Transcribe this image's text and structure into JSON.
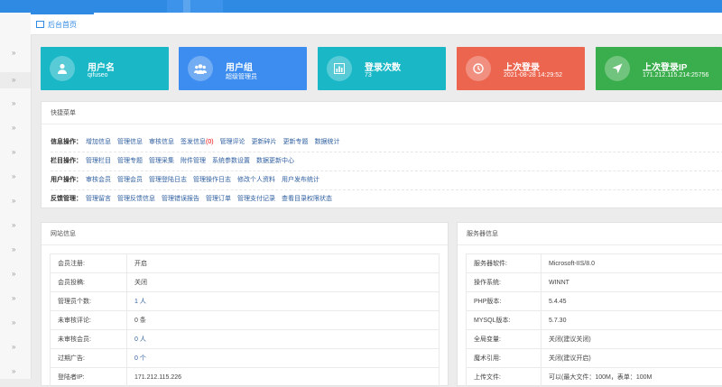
{
  "tab": {
    "label": "后台首页"
  },
  "stats": [
    {
      "title": "用户名",
      "value": "qifuseo",
      "color": "#1ab7c7",
      "icon": "user-icon"
    },
    {
      "title": "用户组",
      "value": "超级管理员",
      "color": "#3c8def",
      "icon": "group-icon"
    },
    {
      "title": "登录次数",
      "value": "73",
      "color": "#1ab7c7",
      "icon": "chart-icon"
    },
    {
      "title": "上次登录",
      "value": "2021-08-28 14:29:52",
      "color": "#ec654f",
      "icon": "clock-icon"
    },
    {
      "title": "上次登录IP",
      "value": "171.212.115.214:25756",
      "color": "#3aae4c",
      "icon": "location-arrow-icon"
    }
  ],
  "quick_menu": {
    "title": "快捷菜单",
    "rows": [
      {
        "label": "信息操作：",
        "links": [
          "增加信息",
          "管理信息",
          "审核信息",
          "签发信息",
          "管理评论",
          "更新碎片",
          "更新专题",
          "数据统计"
        ],
        "badge": "(0)"
      },
      {
        "label": "栏目操作：",
        "links": [
          "管理栏目",
          "管理专题",
          "管理采集",
          "附件管理",
          "系统参数设置",
          "数据更新中心"
        ]
      },
      {
        "label": "用户操作：",
        "links": [
          "审核会员",
          "管理会员",
          "管理登陆日志",
          "管理操作日志",
          "修改个人资料",
          "用户发布统计"
        ]
      },
      {
        "label": "反馈管理：",
        "links": [
          "管理留言",
          "管理反馈信息",
          "管理错误报告",
          "管理订单",
          "管理支付记录",
          "查看目录权限状态"
        ]
      }
    ]
  },
  "site_info": {
    "title": "网站信息",
    "rows": [
      {
        "k": "会员注册:",
        "v": "开启"
      },
      {
        "k": "会员投稿:",
        "v": "关闭"
      },
      {
        "k": "管理员个数:",
        "v": "1 人"
      },
      {
        "k": "未审核评论:",
        "v": "0 条"
      },
      {
        "k": "未审核会员:",
        "v": "0 人"
      },
      {
        "k": "过期广告:",
        "v": "0 个"
      },
      {
        "k": "登陆者IP:",
        "v": "171.212.115.226"
      }
    ]
  },
  "server_info": {
    "title": "服务器信息",
    "rows": [
      {
        "k": "服务器软件:",
        "v": "Microsoft-IIS/8.0"
      },
      {
        "k": "操作系统:",
        "v": "WINNT"
      },
      {
        "k": "PHP版本:",
        "v": "5.4.45"
      },
      {
        "k": "MYSQL版本:",
        "v": "5.7.30"
      },
      {
        "k": "全局变量:",
        "v": "关闭(建议关闭)"
      },
      {
        "k": "魔术引用:",
        "v": "关闭(建议开启)"
      },
      {
        "k": "上传文件:",
        "v": "可以(最大文件：100M，表单：100M"
      }
    ]
  }
}
